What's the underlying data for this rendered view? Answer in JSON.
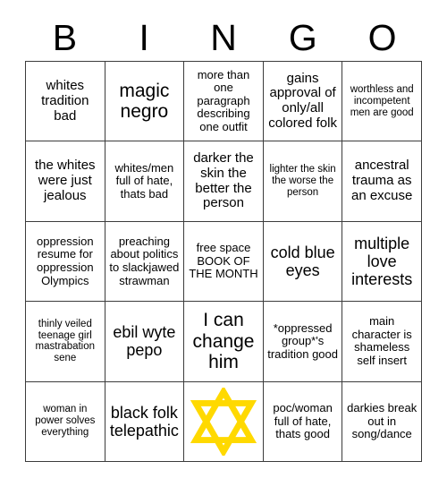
{
  "card": {
    "title_letters": [
      "B",
      "I",
      "N",
      "G",
      "O"
    ],
    "free_space_marked": true,
    "marker": {
      "icon": "star-of-david-icon",
      "color": "#FFD900",
      "cell_row": 5,
      "cell_column": 3
    },
    "colors": {
      "background": "#FFFFFF",
      "text": "#000000",
      "grid_line": "#3C3C3C",
      "marker": "#FFD900"
    },
    "rows": [
      [
        {
          "text": "whites tradition bad",
          "size": "md"
        },
        {
          "text": "magic negro",
          "size": "xl"
        },
        {
          "text": "more than one paragraph describing one outfit",
          "size": "sm"
        },
        {
          "text": "gains approval of only/all colored folk",
          "size": "md"
        },
        {
          "text": "worthless and incompetent men are good",
          "size": "xs"
        }
      ],
      [
        {
          "text": "the whites were just jealous",
          "size": "md"
        },
        {
          "text": "whites/men full of hate, thats bad",
          "size": "sm"
        },
        {
          "text": "darker the skin the better the person",
          "size": "md"
        },
        {
          "text": "lighter the skin the worse the person",
          "size": "xs"
        },
        {
          "text": "ancestral trauma as an excuse",
          "size": "md"
        }
      ],
      [
        {
          "text": "oppression resume for oppression Olympics",
          "size": "sm"
        },
        {
          "text": "preaching about politics to slackjawed strawman",
          "size": "sm"
        },
        {
          "text": "free space BOOK OF THE MONTH",
          "size": "sm"
        },
        {
          "text": "cold blue eyes",
          "size": "lg"
        },
        {
          "text": "multiple love interests",
          "size": "lg"
        }
      ],
      [
        {
          "text": "thinly veiled teenage girl mastrabation sene",
          "size": "xs"
        },
        {
          "text": "ebil wyte pepo",
          "size": "lg"
        },
        {
          "text": "I can change him",
          "size": "xl"
        },
        {
          "text": "*oppressed group*'s tradition good",
          "size": "sm"
        },
        {
          "text": "main character is shameless self insert",
          "size": "sm"
        }
      ],
      [
        {
          "text": "woman in power solves everything",
          "size": "xs"
        },
        {
          "text": "black folk telepathic",
          "size": "lg"
        },
        {
          "text": "",
          "size": "md"
        },
        {
          "text": "poc/woman full of hate, thats good",
          "size": "sm"
        },
        {
          "text": "darkies break out in song/dance",
          "size": "sm"
        }
      ]
    ]
  }
}
